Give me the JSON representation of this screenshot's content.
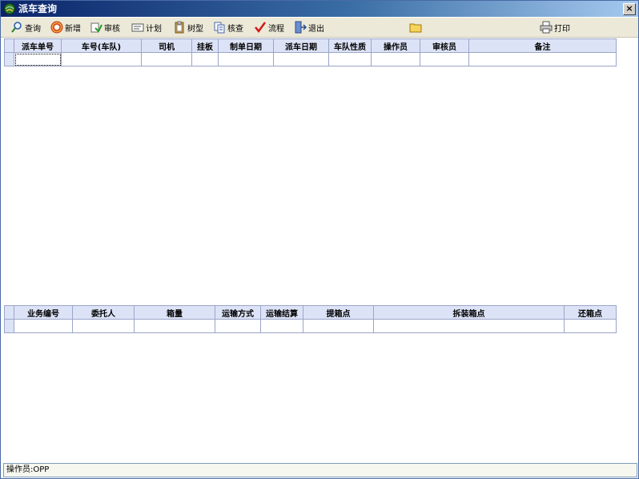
{
  "window": {
    "title": "派车查询",
    "close_symbol": "×"
  },
  "toolbar": {
    "query": "查询",
    "add": "新增",
    "audit": "审核",
    "plan": "计划",
    "tree": "树型",
    "check": "核查",
    "flow": "流程",
    "exit": "退出",
    "print": "打印"
  },
  "top_grid": {
    "columns": [
      "派车单号",
      "车号(车队)",
      "司机",
      "挂板",
      "制单日期",
      "派车日期",
      "车队性质",
      "操作员",
      "审核员",
      "备注"
    ]
  },
  "bottom_grid": {
    "columns": [
      "业务编号",
      "委托人",
      "箱量",
      "运输方式",
      "运输结算",
      "提箱点",
      "拆装箱点",
      "还箱点"
    ]
  },
  "status": {
    "operator": "操作员:OPP"
  }
}
